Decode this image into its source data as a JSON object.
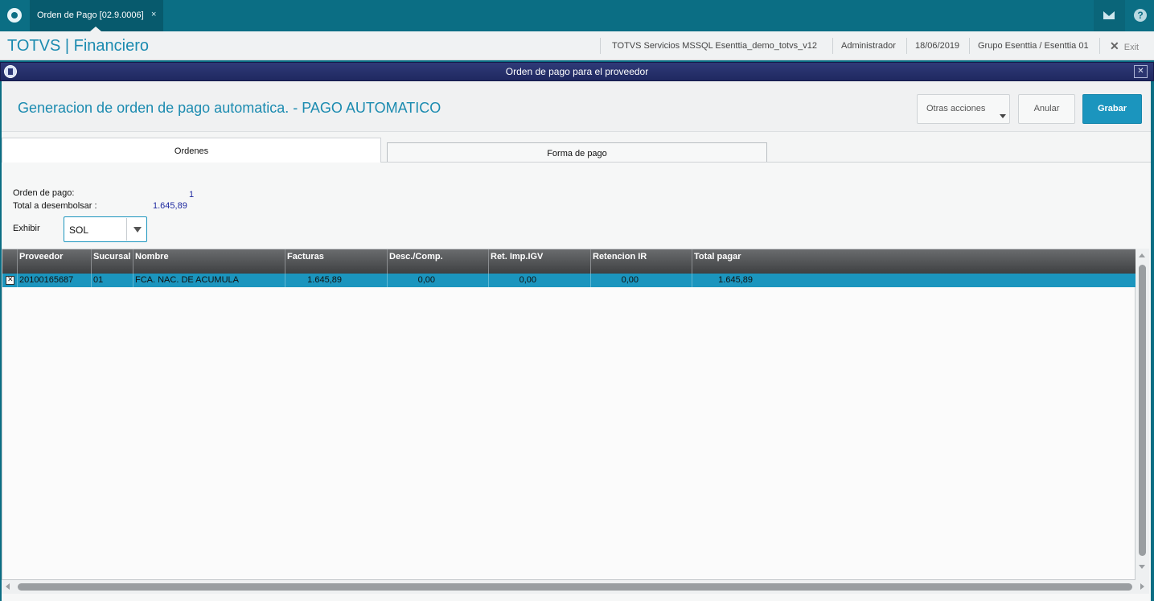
{
  "top_tab": {
    "title": "Orden de Pago [02.9.0006]",
    "close": "×"
  },
  "header": {
    "brand": "TOTVS | Financiero",
    "server": "TOTVS Servicios MSSQL Esenttia_demo_totvs_v12",
    "user": "Administrador",
    "date": "18/06/2019",
    "company": "Grupo Esenttia / Esenttia 01",
    "exit_label": "Exit"
  },
  "dialog": {
    "title": "Orden de pago para el proveedor",
    "close": "✕"
  },
  "page": {
    "title": "Generacion de orden de pago automatica. - PAGO AUTOMATICO",
    "buttons": {
      "otras": "Otras acciones",
      "anular": "Anular",
      "grabar": "Grabar"
    }
  },
  "tabs": [
    {
      "label": "Ordenes",
      "active": true
    },
    {
      "label": "Forma de pago",
      "active": false
    }
  ],
  "summary": {
    "orden_label": "Orden de pago:",
    "orden_value": "1",
    "total_label": "Total a desembolsar :",
    "total_value": "1.645,89",
    "exhibir_label": "Exhibir",
    "exhibir_value": "SOL"
  },
  "grid": {
    "columns": [
      "Proveedor",
      "Sucursal",
      "Nombre",
      "Facturas",
      "Desc./Comp.",
      "Ret. Imp.IGV",
      "Retencion IR",
      "Total pagar"
    ],
    "rows": [
      [
        "20100165687",
        "01",
        "FCA. NAC. DE ACUMULA",
        "1.645,89",
        "0,00",
        "0,00",
        "0,00",
        "1.645,89"
      ]
    ]
  },
  "colors": {
    "teal": "#0b6e84",
    "accent": "#1b95be",
    "dialog_title": "#2f3a78"
  },
  "icons": [
    "totvs-logo-icon",
    "mail-icon",
    "help-icon",
    "close-icon",
    "dialog-app-icon",
    "dropdown-arrow-icon",
    "checkbox-icon",
    "mouse-cursor-icon"
  ]
}
